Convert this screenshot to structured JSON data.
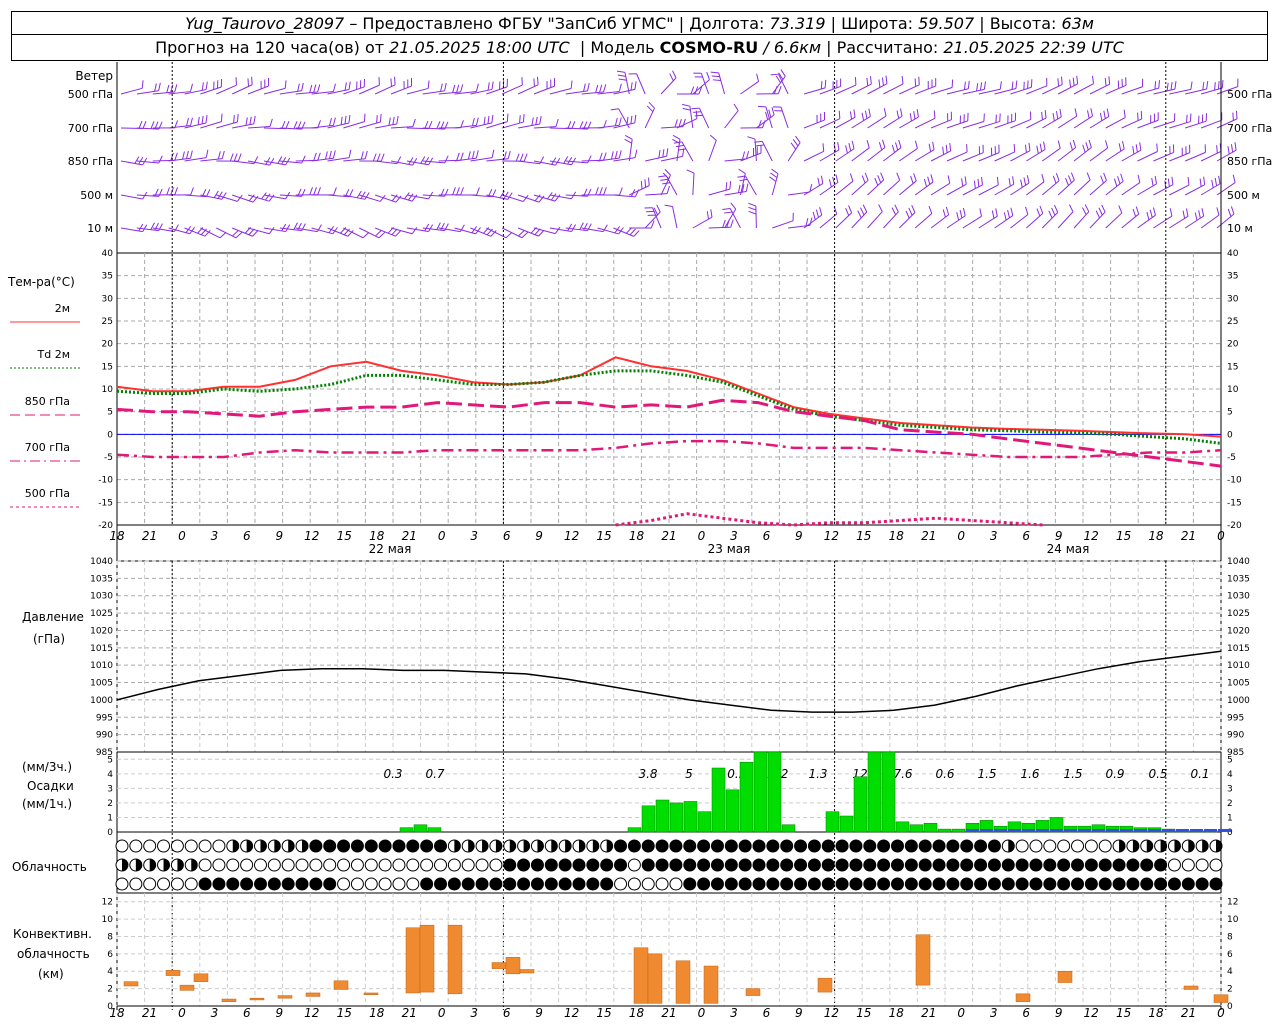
{
  "header": {
    "station": "Yug_Taurovo_28097",
    "provided_by": "Предоставлено ФГБУ \"ЗапСиб УГМС\"",
    "lon_label": "Долгота:",
    "lon_value": "73.319",
    "lat_label": "Широта:",
    "lat_value": "59.507",
    "alt_label": "Высота:",
    "alt_value": "63м",
    "forecast_label": "Прогноз на 120 часа(ов) от",
    "forecast_start": "21.05.2025 18:00 UTC",
    "model_label": "Модель",
    "model_name": "COSMO-RU",
    "model_res": "/ 6.6км",
    "computed_label": "Рассчитано:",
    "computed_value": "21.05.2025 22:39 UTC"
  },
  "wind_panel": {
    "title": "Ветер",
    "levels": [
      "500 гПа",
      "700 гПа",
      "850 гПа",
      "500 м",
      "10 м"
    ],
    "barb_color": "#8a2be2"
  },
  "temp_panel": {
    "title": "Тем-ра(°C)",
    "legend": [
      {
        "label": "2м",
        "color": "#ff3030",
        "style": "solid"
      },
      {
        "label": "Td 2м",
        "color": "#008000",
        "style": "dotted"
      },
      {
        "label": "850 гПа",
        "color": "#e0187a",
        "style": "dash"
      },
      {
        "label": "700 гПа",
        "color": "#e0187a",
        "style": "dashdot"
      },
      {
        "label": "500 гПа",
        "color": "#e0187a",
        "style": "dot"
      }
    ],
    "ticks": [
      "40",
      "35",
      "30",
      "25",
      "20",
      "15",
      "10",
      "5",
      "0",
      "-5",
      "-10",
      "-15",
      "-20"
    ]
  },
  "time_axis": {
    "hour_labels": [
      "18",
      "21",
      "0",
      "3",
      "6",
      "9",
      "12",
      "15",
      "18",
      "21",
      "0",
      "3",
      "6",
      "9",
      "12",
      "15",
      "18",
      "21",
      "0",
      "3",
      "6",
      "9",
      "12",
      "15",
      "18",
      "21",
      "0",
      "3",
      "6",
      "9",
      "12",
      "15",
      "18",
      "21",
      "0"
    ],
    "day_labels": [
      "22 мая",
      "23 мая",
      "24 мая"
    ]
  },
  "pressure_panel": {
    "title": "Давление",
    "unit": "(гПа)",
    "ticks": [
      "1040",
      "1035",
      "1030",
      "1025",
      "1020",
      "1015",
      "1010",
      "1005",
      "1000",
      "995",
      "990",
      "985"
    ]
  },
  "precip_panel": {
    "unit3h": "(мм/3ч.)",
    "title": "Осадки",
    "unit1h": "(мм/1ч.)",
    "ticks": [
      "5",
      "4",
      "3",
      "2",
      "1",
      "0"
    ],
    "totals": [
      "0.3",
      "0.7",
      "3.8",
      "5",
      "10.5",
      "12.2",
      "1.3",
      "12",
      "7.6",
      "0.6",
      "1.5",
      "1.6",
      "1.5",
      "0.9",
      "0.5",
      "0.1"
    ]
  },
  "cloud_panel": {
    "title": "Облачность"
  },
  "convective_panel": {
    "title1": "Конвективн.",
    "title2": "облачность",
    "unit": "(км)",
    "ticks": [
      "12",
      "10",
      "8",
      "6",
      "4",
      "2",
      "0"
    ]
  },
  "chart_data": {
    "type": "line",
    "x_hours": [
      18,
      21,
      0,
      3,
      6,
      9,
      12,
      15,
      18,
      21,
      0,
      3,
      6,
      9,
      12,
      15,
      18,
      21,
      0,
      3,
      6,
      9,
      12,
      15,
      18,
      21,
      0,
      3,
      6,
      9,
      12,
      15,
      18,
      21,
      0,
      3,
      6,
      9,
      12,
      15,
      18,
      21,
      0
    ],
    "series": [
      {
        "name": "2м",
        "unit": "°C",
        "values": [
          10.5,
          9.5,
          9.5,
          10.5,
          10.5,
          12,
          15,
          16,
          14,
          13,
          11.5,
          11,
          11.5,
          13,
          17,
          15,
          14,
          12,
          9,
          6,
          4.5,
          3.5,
          2.5,
          2,
          1.5,
          1.2,
          1,
          0.8,
          0.5,
          0.2,
          0,
          -0.5
        ]
      },
      {
        "name": "Td 2м",
        "unit": "°C",
        "values": [
          9.5,
          9,
          9,
          10,
          9.5,
          10,
          11,
          13,
          13,
          12,
          11,
          11,
          11.5,
          13,
          14,
          14,
          13,
          11.5,
          8.5,
          5.5,
          4,
          3,
          2,
          1.5,
          1,
          0.8,
          0.5,
          0.3,
          0,
          -0.5,
          -1,
          -2
        ]
      },
      {
        "name": "850 гПа",
        "unit": "°C",
        "values": [
          5.5,
          5,
          5,
          4.5,
          4,
          5,
          5.5,
          6,
          6,
          7,
          6.5,
          6,
          7,
          7,
          6,
          6.5,
          6,
          7.5,
          7,
          5,
          4,
          3,
          1,
          0.5,
          0,
          -1,
          -2,
          -3,
          -4,
          -5,
          -6,
          -7
        ]
      },
      {
        "name": "700 гПа",
        "unit": "°C",
        "values": [
          -4.5,
          -5,
          -5,
          -5,
          -4,
          -3.5,
          -4,
          -4,
          -4,
          -3.5,
          -3.5,
          -3.5,
          -3.5,
          -3.5,
          -3,
          -2,
          -1.5,
          -1.5,
          -2,
          -3,
          -3,
          -3,
          -3.5,
          -4,
          -4.5,
          -5,
          -5,
          -5,
          -4.5,
          -4,
          -4,
          -3.5
        ]
      },
      {
        "name": "500 гПа",
        "unit": "°C",
        "values": [
          null,
          null,
          null,
          null,
          null,
          null,
          null,
          null,
          null,
          null,
          null,
          null,
          null,
          null,
          -20,
          -19,
          -17.5,
          -18.5,
          -19.5,
          -20,
          -19.5,
          -19.5,
          -19,
          -18.5,
          -19,
          -19.5,
          -20,
          null,
          null,
          null,
          null,
          null
        ]
      },
      {
        "name": "Давление",
        "unit": "гПа",
        "values": [
          1000,
          1003,
          1005.5,
          1007,
          1008.5,
          1009,
          1009,
          1008.5,
          1008.5,
          1008,
          1007.5,
          1006,
          1004,
          1002,
          1000,
          998.5,
          997,
          996.5,
          996.5,
          997,
          998.5,
          1001,
          1004,
          1006.5,
          1009,
          1011,
          1012.5,
          1014
        ]
      }
    ],
    "precip_3h_totals": [
      0.3,
      0.7,
      3.8,
      5,
      10.5,
      12.2,
      1.3,
      12,
      7.6,
      0.6,
      1.5,
      1.6,
      1.5,
      0.9,
      0.5,
      0.1
    ],
    "ylim_temp": [
      -20,
      40
    ],
    "ylim_pressure": [
      985,
      1040
    ],
    "ylim_precip": [
      0,
      5.5
    ],
    "ylim_convective": [
      0,
      13
    ]
  }
}
